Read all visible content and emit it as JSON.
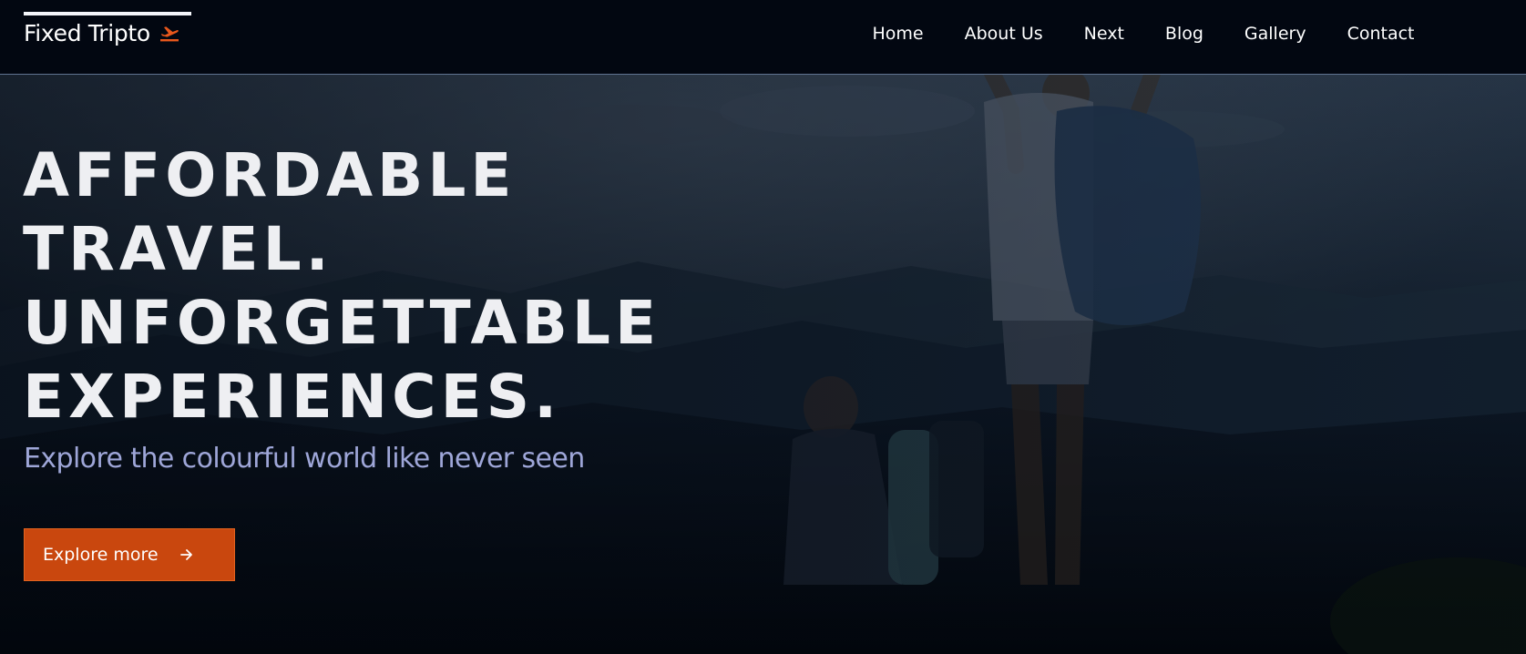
{
  "header": {
    "brand_name": "Fixed Tripto",
    "brand_icon": "plane-icon",
    "nav": [
      {
        "label": "Home"
      },
      {
        "label": "About Us"
      },
      {
        "label": "Next"
      },
      {
        "label": "Blog"
      },
      {
        "label": "Gallery"
      },
      {
        "label": "Contact"
      }
    ]
  },
  "hero": {
    "title_lines": [
      "AFFORDABLE",
      "TRAVEL.",
      "UNFORGETTABLE",
      "EXPERIENCES."
    ],
    "subtitle": "Explore the colourful world like never seen",
    "cta_label": "Explore more",
    "cta_icon": "arrow-right-icon",
    "background": "hikers-on-mountain-photo"
  },
  "colors": {
    "accent": "#c9470e",
    "header_bg": "#020711",
    "subtitle": "#9ea6d8",
    "title": "#eeeff2"
  }
}
